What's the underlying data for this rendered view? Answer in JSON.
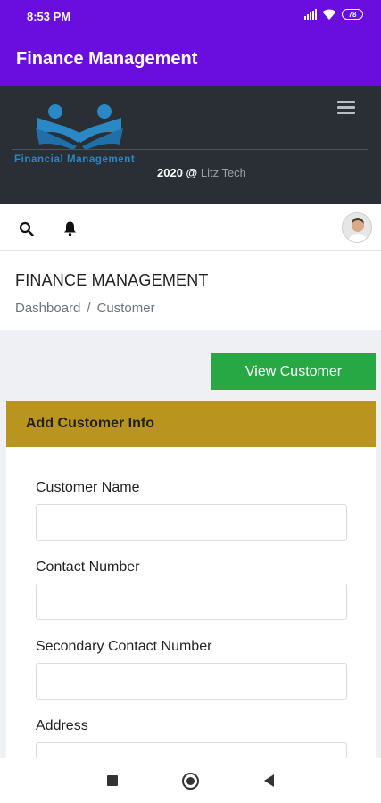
{
  "status_bar": {
    "time": "8:53 PM",
    "battery": "78",
    "icons": [
      "signal-icon",
      "wifi-icon",
      "battery-icon"
    ]
  },
  "app_bar": {
    "title": "Finance Management"
  },
  "banner": {
    "logo_text": "Financial Management",
    "credit_year": "2020 @",
    "credit_name": "Litz Tech",
    "menu_icon": "hamburger-icon"
  },
  "icon_bar": {
    "icons": [
      "search-icon",
      "bell-icon",
      "avatar"
    ]
  },
  "page_header": {
    "title": "FINANCE MANAGEMENT",
    "breadcrumb": [
      "Dashboard",
      "/",
      "Customer"
    ]
  },
  "content": {
    "view_button": "View Customer",
    "card_title": "Add Customer Info",
    "fields": [
      {
        "label": "Customer Name",
        "value": "",
        "placeholder": ""
      },
      {
        "label": "Contact Number",
        "value": "",
        "placeholder": ""
      },
      {
        "label": "Secondary Contact Number",
        "value": "",
        "placeholder": ""
      },
      {
        "label": "Address",
        "value": "",
        "placeholder": ""
      }
    ]
  },
  "colors": {
    "app_bar": "#6a0ee0",
    "banner": "#2a2f35",
    "button_green": "#28a745",
    "card_header": "#b9941f",
    "logo_blue": "#2a88c5"
  },
  "nav_bar": {
    "icons": [
      "recents-icon",
      "home-icon",
      "back-icon"
    ]
  }
}
